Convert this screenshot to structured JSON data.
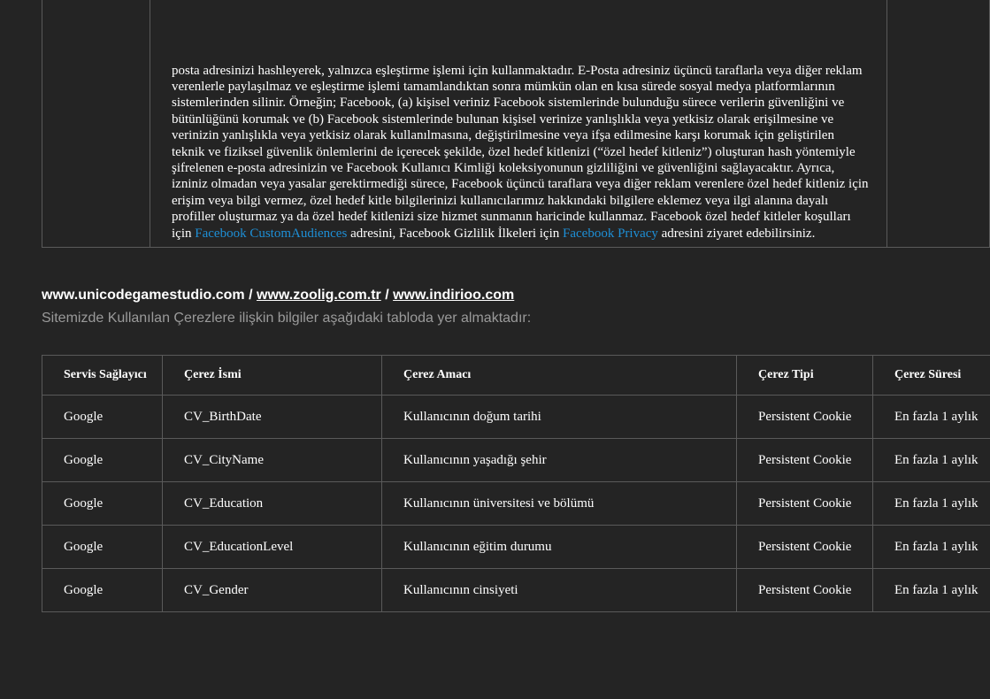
{
  "top_paragraph": {
    "text_1": "posta adresinizi hashleyerek, yalnızca eşleştirme işlemi için kullanmaktadır. E-Posta adresiniz üçüncü taraflarla veya diğer reklam verenlerle paylaşılmaz ve eşleştirme işlemi tamamlandıktan sonra mümkün olan en kısa sürede sosyal medya platformlarının sistemlerinden silinir. Örneğin; Facebook, (a) kişisel veriniz Facebook sistemlerinde bulunduğu sürece verilerin güvenliğini ve bütünlüğünü korumak ve (b) Facebook sistemlerinde bulunan kişisel verinize yanlışlıkla veya yetkisiz olarak erişilmesine ve verinizin yanlışlıkla veya yetkisiz olarak kullanılmasına, değiştirilmesine veya ifşa edilmesine karşı korumak için geliştirilen teknik ve fiziksel güvenlik önlemlerini de içerecek şekilde, özel hedef kitlenizi (“özel hedef kitleniz”) oluşturan hash yöntemiyle şifrelenen e-posta adresinizin ve Facebook Kullanıcı Kimliği koleksiyonunun gizliliğini ve güvenliğini sağlayacaktır. Ayrıca, izniniz olmadan veya yasalar gerektirmediği sürece, Facebook üçüncü taraflara veya diğer reklam verenlere özel hedef kitleniz için erişim veya bilgi vermez, özel hedef kitle bilgilerinizi kullanıcılarımız hakkındaki bilgilere eklemez veya ilgi alanına dayalı profiller oluşturmaz ya da özel hedef kitlenizi size hizmet sunmanın haricinde kullanmaz. Facebook özel hedef kitleler koşulları için ",
    "link_1": "Facebook CustomAudiences",
    "text_2": " adresini, Facebook Gizlilik İlkeleri için ",
    "link_2": "Facebook Privacy",
    "text_3": " adresini ziyaret edebilirsiniz."
  },
  "sites": {
    "site_1": "www.unicodegamestudio.com",
    "separator": " / ",
    "site_2": "www.zoolig.com.tr",
    "site_3": "www.indirioo.com"
  },
  "intro_text": "Sitemizde Kullanılan Çerezlere ilişkin bilgiler aşağıdaki tabloda yer almaktadır:",
  "cookie_table": {
    "headers": {
      "provider": "Servis Sağlayıcı",
      "name": "Çerez İsmi",
      "purpose": "Çerez Amacı",
      "type": "Çerez Tipi",
      "duration": "Çerez Süresi"
    },
    "rows": [
      {
        "provider": "Google",
        "name": "CV_BirthDate",
        "purpose": "Kullanıcının doğum tarihi",
        "type": "Persistent Cookie",
        "duration": "En fazla 1 aylık"
      },
      {
        "provider": "Google",
        "name": "CV_CityName",
        "purpose": "Kullanıcının yaşadığı şehir",
        "type": "Persistent Cookie",
        "duration": "En fazla 1 aylık"
      },
      {
        "provider": "Google",
        "name": "CV_Education",
        "purpose": "Kullanıcının üniversitesi ve bölümü",
        "type": "Persistent Cookie",
        "duration": "En fazla 1 aylık"
      },
      {
        "provider": "Google",
        "name": "CV_EducationLevel",
        "purpose": "Kullanıcının eğitim durumu",
        "type": "Persistent Cookie",
        "duration": "En fazla 1 aylık"
      },
      {
        "provider": "Google",
        "name": "CV_Gender",
        "purpose": "Kullanıcının cinsiyeti",
        "type": "Persistent Cookie",
        "duration": "En fazla 1 aylık"
      }
    ]
  },
  "colors": {
    "background": "#242424",
    "text": "#ffffff",
    "muted_text": "#9a9a9a",
    "link": "#1e8fd6",
    "border": "#5a5a5a"
  }
}
